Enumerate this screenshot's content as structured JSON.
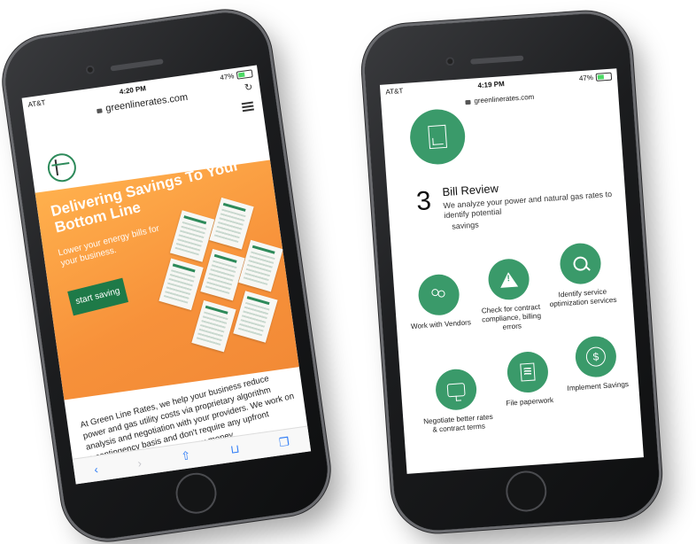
{
  "left_phone": {
    "status": {
      "carrier": "AT&T",
      "time": "4:20 PM",
      "battery": "47%",
      "battery_level": 0.47
    },
    "url": "greenlinerates.com",
    "hero": {
      "title": "Delivering Savings To Your Bottom Line",
      "subtitle": "Lower your energy bills for your business.",
      "cta": "start saving"
    },
    "paragraph": "At Green Line Rates, we help your business reduce power and gas utility costs via proprietary algorithm analysis and negotiation with your providers.  We work on a contingency basis and don't require any upfront payment to save your company money.",
    "toolbar_icons": [
      "back-icon",
      "forward-icon",
      "share-icon",
      "bookmarks-icon",
      "tabs-icon"
    ]
  },
  "right_phone": {
    "status": {
      "carrier": "AT&T",
      "time": "4:19 PM",
      "battery": "47%",
      "battery_level": 0.47
    },
    "url": "greenlinerates.com",
    "step": {
      "number": "3",
      "title": "Bill Review",
      "description": "We analyze your power and natural gas rates to identify potential",
      "description_tail": "savings"
    },
    "services": [
      {
        "label": "Work with Vendors",
        "icon": "people-icon"
      },
      {
        "label": "Check for contract compliance, billing errors",
        "icon": "warning-icon"
      },
      {
        "label": "Identify service optimization services",
        "icon": "search-icon"
      },
      {
        "label": "Negotiate better rates & contract terms",
        "icon": "chat-icon"
      },
      {
        "label": "File paperwork",
        "icon": "documents-icon"
      },
      {
        "label": "Implement Savings",
        "icon": "dollar-icon"
      }
    ]
  },
  "colors": {
    "brand_green": "#3a9a6a",
    "button_green": "#1e7a48",
    "hero_orange": "#f7913a"
  }
}
